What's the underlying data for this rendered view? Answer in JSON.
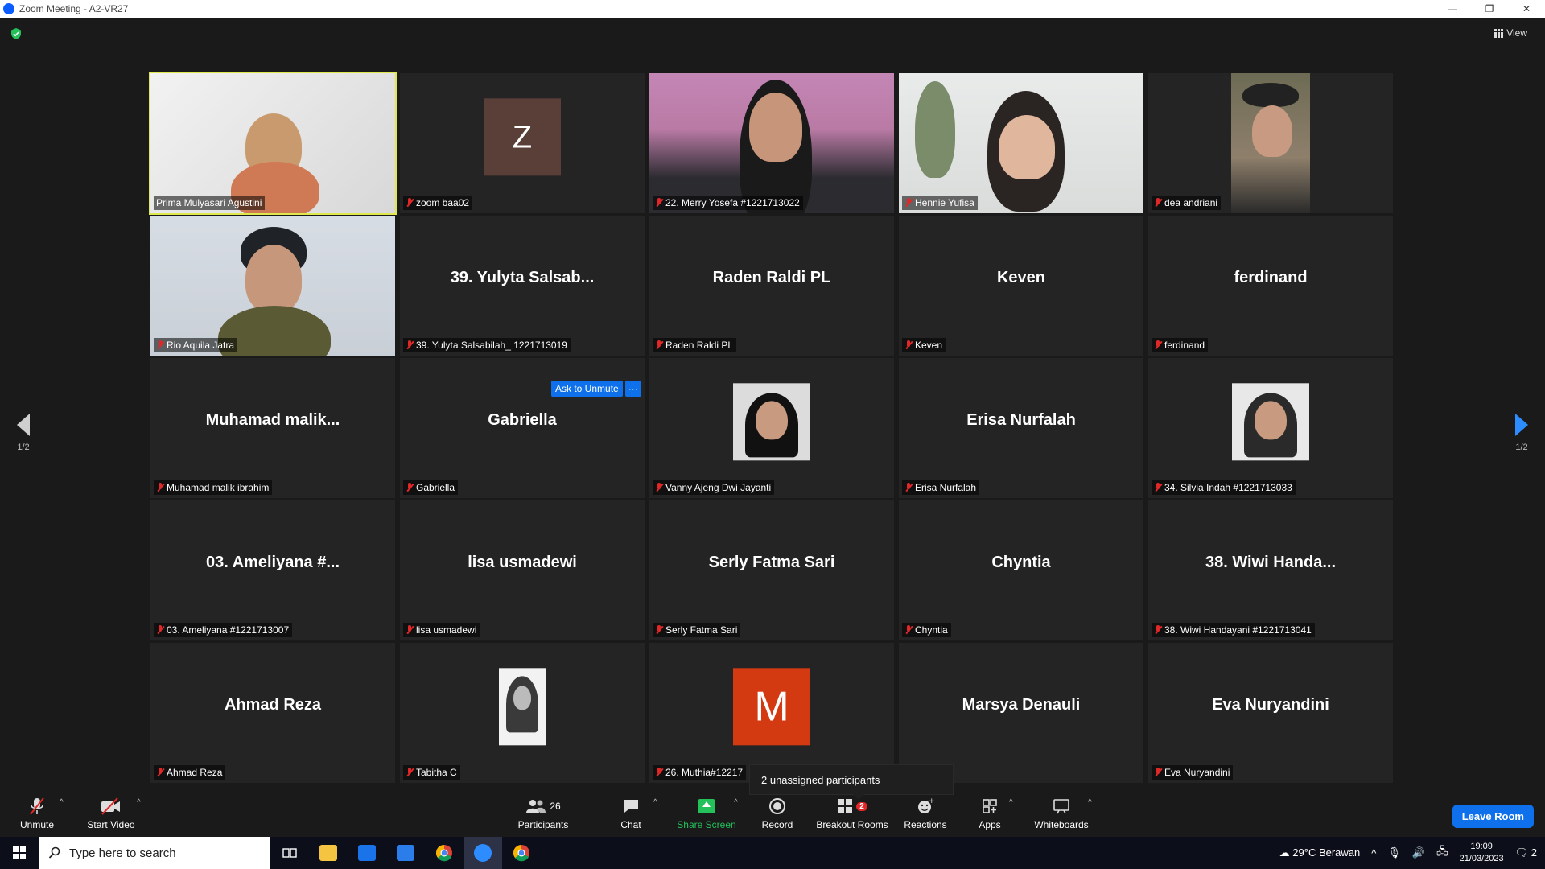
{
  "window": {
    "title": "Zoom Meeting - A2-VR27",
    "controls": [
      "—",
      "❐",
      "✕"
    ]
  },
  "view_label": "View",
  "pagination": {
    "left": "1/2",
    "right": "1/2"
  },
  "tiles": [
    {
      "display": "",
      "label": "Prima Mulyasari Agustini",
      "muted": false,
      "type": "video-prima",
      "active": true
    },
    {
      "display": "Z",
      "label": "zoom baa02",
      "muted": true,
      "type": "avatar-z"
    },
    {
      "display": "",
      "label": "22. Merry Yosefa #1221713022",
      "muted": true,
      "type": "video-merry"
    },
    {
      "display": "",
      "label": "Hennie Yufisa",
      "muted": true,
      "type": "video-hennie"
    },
    {
      "display": "",
      "label": "dea andriani",
      "muted": true,
      "type": "video-dea"
    },
    {
      "display": "",
      "label": "Rio Aquila Jatra",
      "muted": true,
      "type": "video-rio"
    },
    {
      "display": "39. Yulyta Salsab...",
      "label": "39. Yulyta Salsabilah_ 1221713019",
      "muted": true,
      "type": "name"
    },
    {
      "display": "Raden Raldi PL",
      "label": "Raden Raldi PL",
      "muted": true,
      "type": "name"
    },
    {
      "display": "Keven",
      "label": "Keven",
      "muted": true,
      "type": "name"
    },
    {
      "display": "ferdinand",
      "label": "ferdinand",
      "muted": true,
      "type": "name"
    },
    {
      "display": "Muhamad  malik...",
      "label": "Muhamad malik ibrahim",
      "muted": true,
      "type": "name"
    },
    {
      "display": "Gabriella",
      "label": "Gabriella",
      "muted": true,
      "type": "name"
    },
    {
      "display": "",
      "label": "Vanny Ajeng Dwi Jayanti",
      "muted": true,
      "type": "avatar-photo"
    },
    {
      "display": "Erisa Nurfalah",
      "label": "Erisa Nurfalah",
      "muted": true,
      "type": "name"
    },
    {
      "display": "",
      "label": "34. Silvia Indah #1221713033",
      "muted": true,
      "type": "avatar-photo-gray"
    },
    {
      "display": "03. Ameliyana #...",
      "label": "03. Ameliyana #1221713007",
      "muted": true,
      "type": "name"
    },
    {
      "display": "lisa usmadewi",
      "label": "lisa usmadewi",
      "muted": true,
      "type": "name"
    },
    {
      "display": "Serly Fatma Sari",
      "label": "Serly Fatma Sari",
      "muted": true,
      "type": "name"
    },
    {
      "display": "Chyntia",
      "label": "Chyntia",
      "muted": true,
      "type": "name"
    },
    {
      "display": "38. Wiwi Handa...",
      "label": "38. Wiwi Handayani #1221713041",
      "muted": true,
      "type": "name"
    },
    {
      "display": "Ahmad Reza",
      "label": "Ahmad Reza",
      "muted": true,
      "type": "name"
    },
    {
      "display": "",
      "label": "Tabitha C",
      "muted": true,
      "type": "avatar-photo-bw"
    },
    {
      "display": "M",
      "label": "26. Muthia#12217",
      "muted": true,
      "type": "avatar-m"
    },
    {
      "display": "Marsya Denauli",
      "label": "Denauli",
      "muted": false,
      "type": "name"
    },
    {
      "display": "Eva Nuryandini",
      "label": "Eva Nuryandini",
      "muted": true,
      "type": "name"
    }
  ],
  "ask_to_unmute": {
    "label": "Ask to Unmute",
    "more": "···"
  },
  "tooltip": "2 unassigned participants",
  "toolbar": {
    "unmute": "Unmute",
    "start_video": "Start Video",
    "participants": "Participants",
    "participants_count": "26",
    "chat": "Chat",
    "share_screen": "Share Screen",
    "record": "Record",
    "breakout_rooms": "Breakout Rooms",
    "breakout_badge": "2",
    "reactions": "Reactions",
    "apps": "Apps",
    "whiteboards": "Whiteboards",
    "leave": "Leave Room"
  },
  "taskbar": {
    "search_placeholder": "Type here to search",
    "weather": "29°C  Berawan",
    "time": "19:09",
    "date": "21/03/2023",
    "notifications": "2"
  },
  "colors": {
    "accent": "#0e71eb",
    "share": "#24c05a",
    "muted": "#e02828",
    "active_border": "#dfe84c"
  }
}
